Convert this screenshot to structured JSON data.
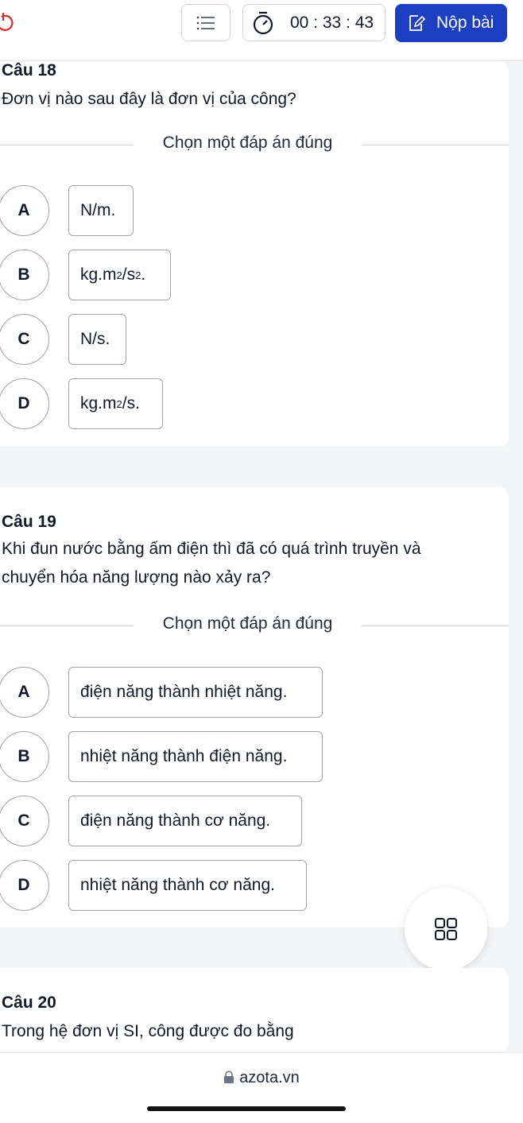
{
  "header": {
    "timer": "00 : 33 : 43",
    "submit_label": "Nộp bài",
    "accent_color": "#1d3fc2"
  },
  "choose_label": "Chọn một đáp án đúng",
  "questions": [
    {
      "title": "Câu 18",
      "text": "Đơn vị nào sau đây là đơn vị của công?",
      "options": [
        {
          "letter": "A",
          "text": "N/m."
        },
        {
          "letter": "B",
          "text": "kg.m²/s².",
          "parts": [
            "kg.m",
            "2",
            "/s",
            "2",
            "."
          ]
        },
        {
          "letter": "C",
          "text": "N/s."
        },
        {
          "letter": "D",
          "text": "kg.m²/s.",
          "parts": [
            "kg.m",
            "2",
            "/s."
          ]
        }
      ]
    },
    {
      "title": "Câu 19",
      "text_lines": [
        "Khi đun nước bằng ấm điện thì đã có quá trình truyền và",
        "chuyển hóa năng lượng nào xảy ra?"
      ],
      "options": [
        {
          "letter": "A",
          "text": "điện năng thành nhiệt năng."
        },
        {
          "letter": "B",
          "text": "nhiệt năng thành điện năng."
        },
        {
          "letter": "C",
          "text": "điện năng thành cơ năng."
        },
        {
          "letter": "D",
          "text": "nhiệt năng thành cơ năng."
        }
      ]
    },
    {
      "title": "Câu 20",
      "text": "Trong hệ đơn vị SI, công được đo bằng"
    }
  ],
  "browser": {
    "url": "azota.vn"
  }
}
